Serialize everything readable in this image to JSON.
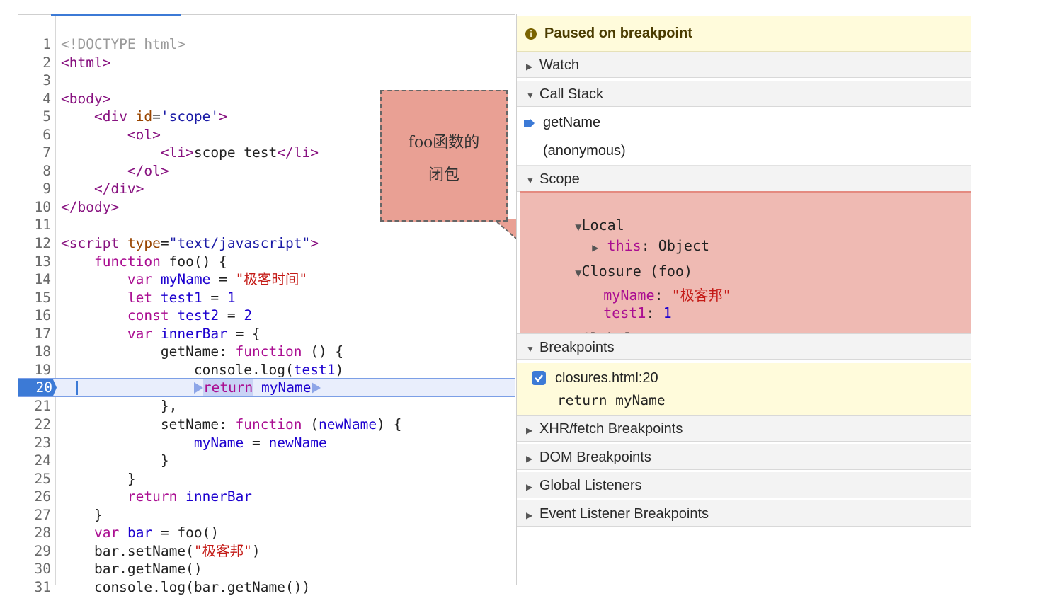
{
  "editor": {
    "current_line": 20,
    "lines": [
      {
        "n": "1",
        "html": "<span class=\"tk-doc\">&lt;!DOCTYPE html&gt;</span>"
      },
      {
        "n": "2",
        "html": "<span class=\"tk-tag\">&lt;html&gt;</span>"
      },
      {
        "n": "3",
        "html": ""
      },
      {
        "n": "4",
        "html": "<span class=\"tk-tag\">&lt;body&gt;</span>"
      },
      {
        "n": "5",
        "html": "    <span class=\"tk-tag\">&lt;div</span> <span class=\"tk-attr\">id</span>=<span class=\"tk-str\">'scope'</span><span class=\"tk-tag\">&gt;</span>"
      },
      {
        "n": "6",
        "html": "        <span class=\"tk-tag\">&lt;ol&gt;</span>"
      },
      {
        "n": "7",
        "html": "            <span class=\"tk-tag\">&lt;li&gt;</span>scope test<span class=\"tk-tag\">&lt;/li&gt;</span>"
      },
      {
        "n": "8",
        "html": "        <span class=\"tk-tag\">&lt;/ol&gt;</span>"
      },
      {
        "n": "9",
        "html": "    <span class=\"tk-tag\">&lt;/div&gt;</span>"
      },
      {
        "n": "10",
        "html": "<span class=\"tk-tag\">&lt;/body&gt;</span>"
      },
      {
        "n": "11",
        "html": ""
      },
      {
        "n": "12",
        "html": "<span class=\"tk-tag\">&lt;script</span> <span class=\"tk-attr\">type</span>=<span class=\"tk-str\">\"text/javascript\"</span><span class=\"tk-tag\">&gt;</span>"
      },
      {
        "n": "13",
        "html": "    <span class=\"tk-kw\">function</span> foo() {"
      },
      {
        "n": "14",
        "html": "        <span class=\"tk-kw\">var</span> <span class=\"tk-var\">myName</span> = <span class=\"tk-cstr\">\"极客时间\"</span>"
      },
      {
        "n": "15",
        "html": "        <span class=\"tk-kw\">let</span> <span class=\"tk-var\">test1</span> = <span class=\"tk-num\">1</span>"
      },
      {
        "n": "16",
        "html": "        <span class=\"tk-kw\">const</span> <span class=\"tk-var\">test2</span> = <span class=\"tk-num\">2</span>"
      },
      {
        "n": "17",
        "html": "        <span class=\"tk-kw\">var</span> <span class=\"tk-var\">innerBar</span> = {"
      },
      {
        "n": "18",
        "html": "            getName: <span class=\"tk-kw\">function</span> () {"
      },
      {
        "n": "19",
        "html": "                console.log(<span class=\"tk-var\">test1</span>)"
      },
      {
        "n": "20",
        "html": "                <span class=\"marker\"></span><span class=\"tk-ret\">return</span> <span class=\"tk-var\">myName</span><span class=\"marker\"></span>"
      },
      {
        "n": "21",
        "html": "            },"
      },
      {
        "n": "22",
        "html": "            setName: <span class=\"tk-kw\">function</span> (<span class=\"tk-var\">newName</span>) {"
      },
      {
        "n": "23",
        "html": "                <span class=\"tk-var\">myName</span> = <span class=\"tk-var\">newName</span>"
      },
      {
        "n": "24",
        "html": "            }"
      },
      {
        "n": "25",
        "html": "        }"
      },
      {
        "n": "26",
        "html": "        <span class=\"tk-kw\">return</span> <span class=\"tk-var\">innerBar</span>"
      },
      {
        "n": "27",
        "html": "    }"
      },
      {
        "n": "28",
        "html": "    <span class=\"tk-kw\">var</span> <span class=\"tk-var\">bar</span> = foo()"
      },
      {
        "n": "29",
        "html": "    bar.setName(<span class=\"tk-cstr\">\"极客邦\"</span>)"
      },
      {
        "n": "30",
        "html": "    bar.getName()"
      },
      {
        "n": "31",
        "html": "    console.log(bar.getName())"
      }
    ]
  },
  "callout": {
    "line1": "foo函数的",
    "line2": "闭包",
    "color": "#e9a094"
  },
  "panel": {
    "paused_label": "Paused on breakpoint",
    "sections": {
      "watch": "Watch",
      "call_stack": "Call Stack",
      "scope": "Scope",
      "breakpoints": "Breakpoints",
      "xhr": "XHR/fetch Breakpoints",
      "dom": "DOM Breakpoints",
      "global_listeners": "Global Listeners",
      "event_listener": "Event Listener Breakpoints"
    },
    "call_stack": [
      "getName",
      "(anonymous)"
    ],
    "scope_tree": {
      "local": "Local",
      "this_key": "this",
      "this_val": "Object",
      "closure": "Closure (foo)",
      "myName_key": "myName",
      "myName_val": "\"极客邦\"",
      "test1_key": "test1",
      "test1_val": "1",
      "global": "Global"
    },
    "breakpoint": {
      "file": "closures.html:20",
      "code": "return myName",
      "checked": true
    }
  }
}
